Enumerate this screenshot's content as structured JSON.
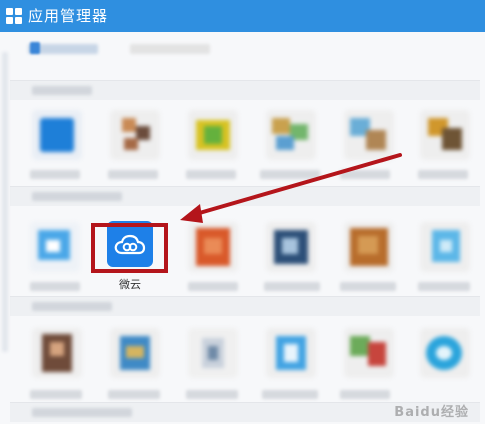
{
  "window": {
    "title": "应用管理器",
    "accent_color": "#2f8fe0"
  },
  "highlighted_app": {
    "label": "微云",
    "icon": "weiyun-cloud-icon",
    "icon_color": "#1e80e8",
    "highlight_color": "#b4151b"
  },
  "annotation": {
    "arrow_color": "#b4151b"
  },
  "watermark": {
    "text": "Baidu经验"
  }
}
